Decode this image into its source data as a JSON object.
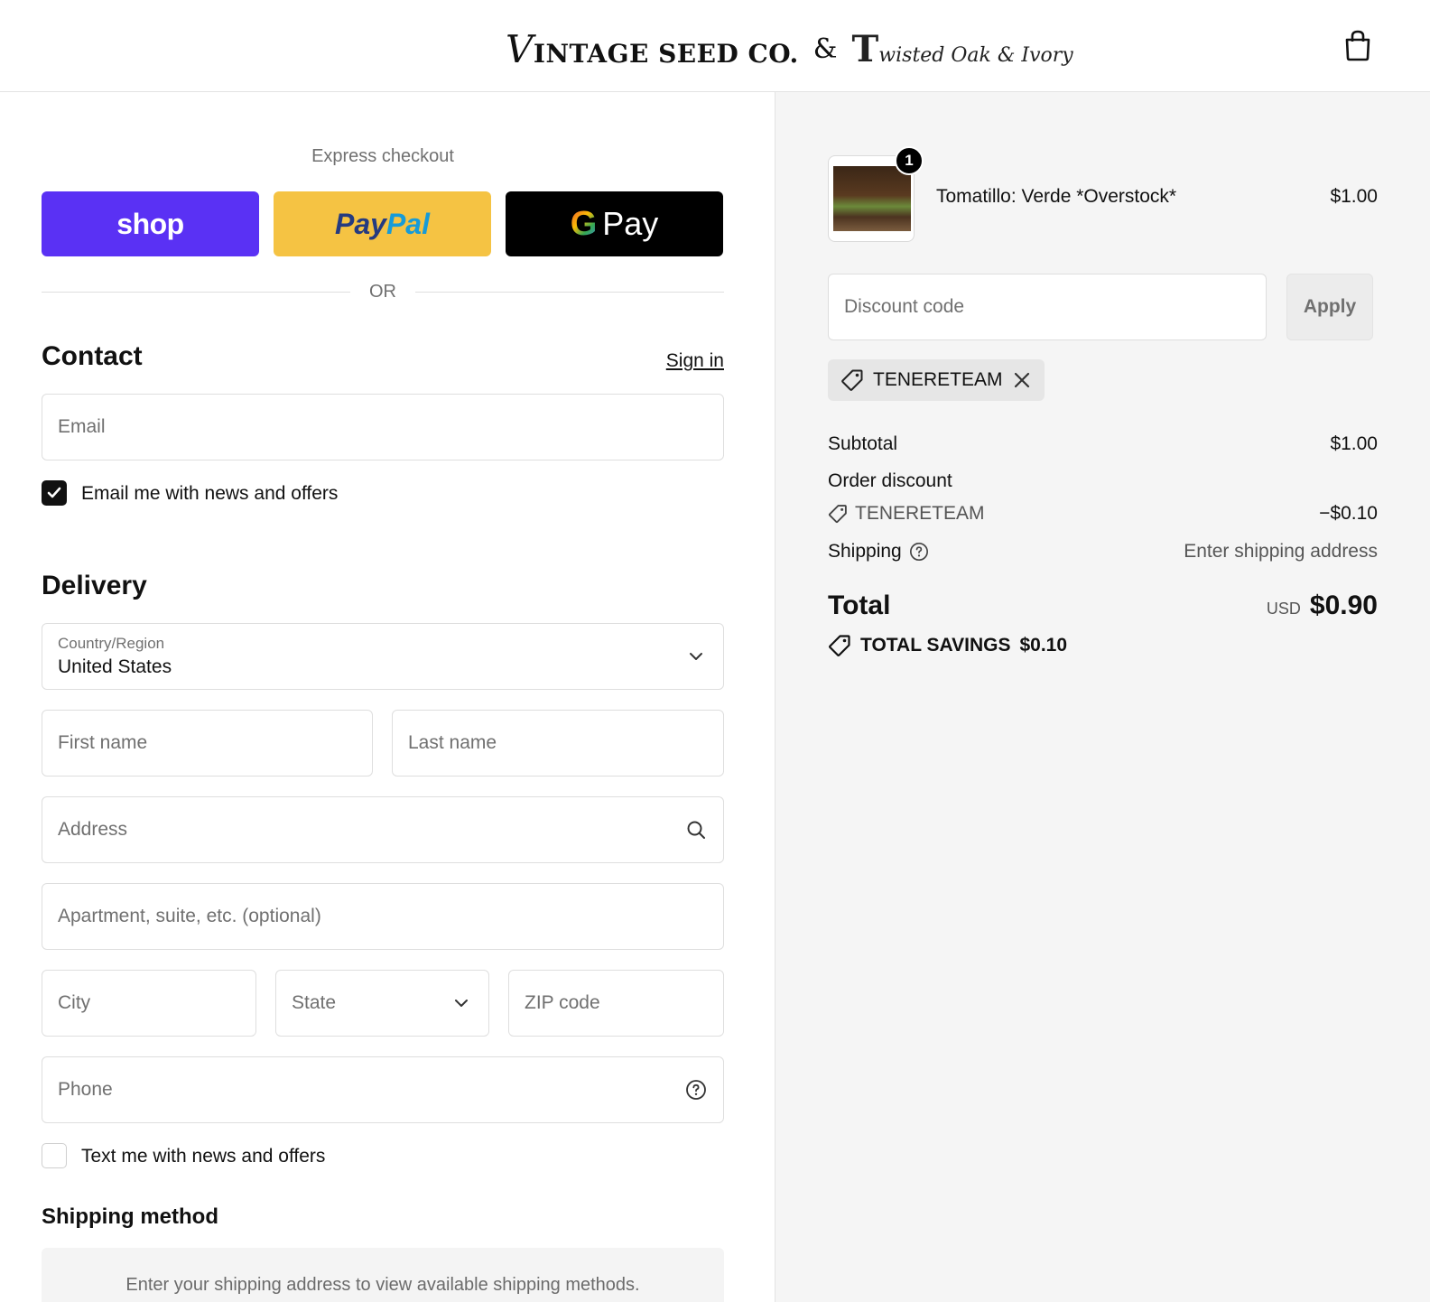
{
  "header": {
    "logo_vintage_initial": "V",
    "logo_vintage_rest": "INTAGE SEED CO.",
    "logo_amp": "&",
    "logo_twisted_initial": "T",
    "logo_twisted_rest": "wisted Oak & Ivory",
    "cart_icon": "shopping-bag-icon"
  },
  "express": {
    "title": "Express checkout",
    "shop_label": "shop",
    "paypal_pay": "Pay",
    "paypal_pal": "Pal",
    "gpay_g": "G",
    "gpay_label": "Pay",
    "or_label": "OR"
  },
  "contact": {
    "heading": "Contact",
    "sign_in": "Sign in",
    "email_placeholder": "Email",
    "email_optin_label": "Email me with news and offers",
    "email_optin_checked": true
  },
  "delivery": {
    "heading": "Delivery",
    "country_label": "Country/Region",
    "country_value": "United States",
    "first_name_placeholder": "First name",
    "last_name_placeholder": "Last name",
    "address_placeholder": "Address",
    "apartment_placeholder": "Apartment, suite, etc. (optional)",
    "city_placeholder": "City",
    "state_placeholder": "State",
    "zip_placeholder": "ZIP code",
    "phone_placeholder": "Phone",
    "sms_optin_label": "Text me with news and offers",
    "sms_optin_checked": false
  },
  "shipping_method": {
    "heading": "Shipping method",
    "note": "Enter your shipping address to view available shipping methods."
  },
  "summary": {
    "item": {
      "quantity": "1",
      "name": "Tomatillo: Verde *Overstock*",
      "price": "$1.00"
    },
    "discount_placeholder": "Discount code",
    "apply_label": "Apply",
    "applied_code": "TENERETEAM",
    "subtotal_label": "Subtotal",
    "subtotal_value": "$1.00",
    "order_discount_label": "Order discount",
    "order_discount_code": "TENERETEAM",
    "order_discount_value": "−$0.10",
    "shipping_label": "Shipping",
    "shipping_value": "Enter shipping address",
    "total_label": "Total",
    "total_currency": "USD",
    "total_value": "$0.90",
    "savings_label": "TOTAL SAVINGS",
    "savings_value": "$0.10"
  },
  "colors": {
    "shop_purple": "#5a31f4",
    "paypal_yellow": "#f5c343",
    "gpay_black": "#000000",
    "summary_bg": "#f5f5f5"
  }
}
